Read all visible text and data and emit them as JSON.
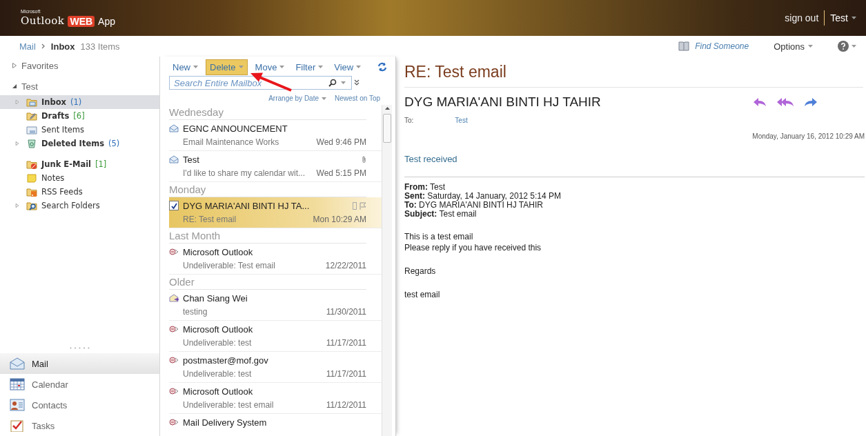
{
  "header": {
    "logo": {
      "maker": "Microsoft",
      "product": "Outlook",
      "web": "WEB",
      "app": "App"
    },
    "sign_out": "sign out",
    "user": "Test"
  },
  "breadcrumb": {
    "root": "Mail",
    "current": "Inbox",
    "count": "133 Items"
  },
  "top_links": {
    "find_someone": "Find Someone",
    "options": "Options"
  },
  "sidebar": {
    "favorites": {
      "label": "Favorites",
      "expanded": false
    },
    "mailbox": {
      "label": "Test",
      "expanded": true,
      "children": [
        {
          "kind": "inbox",
          "label": "Inbox",
          "count": "(1)",
          "color": "#2d6fb8",
          "unread": true,
          "expanded": false,
          "selected": true
        },
        {
          "kind": "drafts",
          "label": "Drafts",
          "count": "[6]",
          "color": "#3a9a3a",
          "unread": true,
          "selected": false
        },
        {
          "kind": "sent",
          "label": "Sent Items",
          "unread": false,
          "selected": false
        },
        {
          "kind": "deleted",
          "label": "Deleted Items",
          "count": "(5)",
          "color": "#2d6fb8",
          "unread": true,
          "expanded": false,
          "selected": false
        },
        {
          "kind": "junk",
          "label": "Junk E-Mail",
          "count": "[1]",
          "color": "#3a9a3a",
          "unread": true,
          "selected": false,
          "gap_before": true
        },
        {
          "kind": "notes",
          "label": "Notes",
          "unread": false,
          "selected": false
        },
        {
          "kind": "rss",
          "label": "RSS Feeds",
          "unread": false,
          "selected": false
        },
        {
          "kind": "search",
          "label": "Search Folders",
          "unread": false,
          "expanded": false,
          "selected": false
        }
      ]
    },
    "nav": [
      {
        "kind": "mail",
        "label": "Mail",
        "selected": true
      },
      {
        "kind": "calendar",
        "label": "Calendar",
        "selected": false
      },
      {
        "kind": "contacts",
        "label": "Contacts",
        "selected": false
      },
      {
        "kind": "tasks",
        "label": "Tasks",
        "selected": false
      }
    ]
  },
  "toolbar": {
    "buttons": [
      {
        "label": "New",
        "highlighted": false
      },
      {
        "label": "Delete",
        "highlighted": true
      },
      {
        "label": "Move",
        "highlighted": false
      },
      {
        "label": "Filter",
        "highlighted": false
      },
      {
        "label": "View",
        "highlighted": false
      }
    ]
  },
  "search": {
    "placeholder": "Search Entire Mailbox"
  },
  "sort": {
    "arrange": "Arrange by Date",
    "order": "Newest on Top"
  },
  "message_groups": [
    {
      "label": "Wednesday",
      "messages": [
        {
          "kind": "read",
          "sender": "EGNC ANNOUNCEMENT",
          "subject": "Email Maintenance Works",
          "time": "Wed 9:46 PM",
          "attachment": false,
          "selected": false
        },
        {
          "kind": "read",
          "sender": "Test",
          "subject": "I'd like to share my calendar wit...",
          "time": "Wed 5:15 PM",
          "attachment": true,
          "selected": false
        }
      ]
    },
    {
      "label": "Monday",
      "messages": [
        {
          "sender": "DYG MARIA'ANI BINTI HJ TA...",
          "subject": "RE: Test email",
          "time": "Mon 10:29 AM",
          "attachment": false,
          "selected": true,
          "checked": true
        }
      ]
    },
    {
      "label": "Last Month",
      "messages": [
        {
          "kind": "undeliverable",
          "sender": "Microsoft Outlook",
          "subject": "Undeliverable: Test email",
          "time": "12/22/2011",
          "attachment": false,
          "selected": false
        }
      ]
    },
    {
      "label": "Older",
      "messages": [
        {
          "kind": "meeting",
          "sender": "Chan Siang Wei",
          "subject": "testing",
          "time": "11/30/2011",
          "attachment": false,
          "selected": false
        },
        {
          "kind": "undeliverable",
          "sender": "Microsoft Outlook",
          "subject": "Undeliverable: test",
          "time": "11/17/2011",
          "attachment": false,
          "selected": false
        },
        {
          "kind": "undeliverable",
          "sender": "postmaster@mof.gov",
          "subject": "Undeliverable: test",
          "time": "11/17/2011",
          "attachment": false,
          "selected": false
        },
        {
          "kind": "undeliverable",
          "sender": "Microsoft Outlook",
          "subject": "Undeliverable: test email",
          "time": "11/12/2011",
          "attachment": false,
          "selected": false
        },
        {
          "kind": "undeliverable",
          "sender": "Mail Delivery System",
          "selected": false,
          "attachment": false
        }
      ]
    }
  ],
  "reading_pane": {
    "subject": "RE: Test email",
    "sender": "DYG MARIA'ANI BINTI HJ TAHIR",
    "to_label": "To:",
    "to": "Test",
    "date": "Monday, January 16, 2012 10:29 AM",
    "body_first": "Test received",
    "quoted_header": [
      "**From:** Test",
      "**Sent:** Saturday, 14 January, 2012 5:14 PM",
      "**To:** DYG MARIA'ANI BINTI HJ TAHIR",
      "**Subject:** Test email"
    ],
    "body": [
      [
        "This is a test email",
        "Please reply if you have received this"
      ],
      [
        "Regards"
      ],
      [
        "test email"
      ]
    ]
  }
}
